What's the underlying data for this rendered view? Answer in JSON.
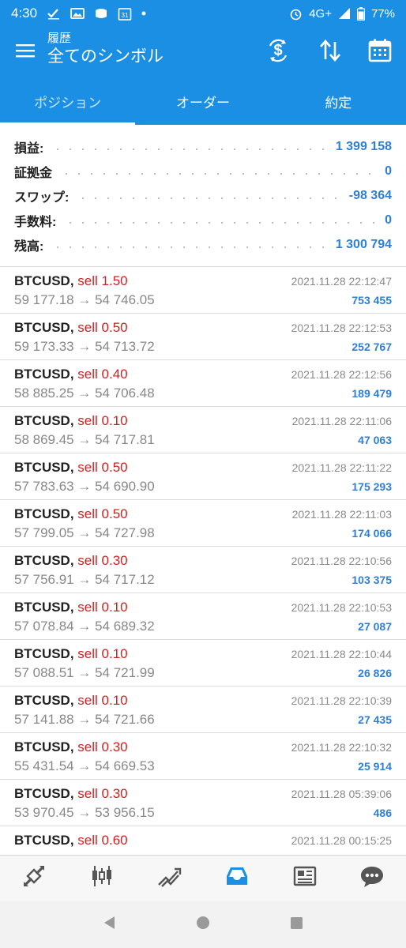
{
  "status_bar": {
    "time": "4:30",
    "network": "4G+",
    "battery": "77%"
  },
  "app_bar": {
    "subtitle": "履歴",
    "title": "全てのシンボル"
  },
  "tabs": [
    {
      "label": "ポジション",
      "active": true
    },
    {
      "label": "オーダー",
      "active": false
    },
    {
      "label": "約定",
      "active": false
    }
  ],
  "summary": [
    {
      "label": "損益:",
      "value": "1 399 158"
    },
    {
      "label": "証拠金",
      "value": "0"
    },
    {
      "label": "スワップ:",
      "value": "-98 364"
    },
    {
      "label": "手数料:",
      "value": "0"
    },
    {
      "label": "残高:",
      "value": "1 300 794"
    }
  ],
  "trades": [
    {
      "symbol": "BTCUSD,",
      "type": "sell 1.50",
      "prices": "59 177.18 → 54 746.05",
      "time": "2021.11.28 22:12:47",
      "profit": "753 455"
    },
    {
      "symbol": "BTCUSD,",
      "type": "sell 0.50",
      "prices": "59 173.33 → 54 713.72",
      "time": "2021.11.28 22:12:53",
      "profit": "252 767"
    },
    {
      "symbol": "BTCUSD,",
      "type": "sell 0.40",
      "prices": "58 885.25 → 54 706.48",
      "time": "2021.11.28 22:12:56",
      "profit": "189 479"
    },
    {
      "symbol": "BTCUSD,",
      "type": "sell 0.10",
      "prices": "58 869.45 → 54 717.81",
      "time": "2021.11.28 22:11:06",
      "profit": "47 063"
    },
    {
      "symbol": "BTCUSD,",
      "type": "sell 0.50",
      "prices": "57 783.63 → 54 690.90",
      "time": "2021.11.28 22:11:22",
      "profit": "175 293"
    },
    {
      "symbol": "BTCUSD,",
      "type": "sell 0.50",
      "prices": "57 799.05 → 54 727.98",
      "time": "2021.11.28 22:11:03",
      "profit": "174 066"
    },
    {
      "symbol": "BTCUSD,",
      "type": "sell 0.30",
      "prices": "57 756.91 → 54 717.12",
      "time": "2021.11.28 22:10:56",
      "profit": "103 375"
    },
    {
      "symbol": "BTCUSD,",
      "type": "sell 0.10",
      "prices": "57 078.84 → 54 689.32",
      "time": "2021.11.28 22:10:53",
      "profit": "27 087"
    },
    {
      "symbol": "BTCUSD,",
      "type": "sell 0.10",
      "prices": "57 088.51 → 54 721.99",
      "time": "2021.11.28 22:10:44",
      "profit": "26 826"
    },
    {
      "symbol": "BTCUSD,",
      "type": "sell 0.10",
      "prices": "57 141.88 → 54 721.66",
      "time": "2021.11.28 22:10:39",
      "profit": "27 435"
    },
    {
      "symbol": "BTCUSD,",
      "type": "sell 0.30",
      "prices": "55 431.54 → 54 669.53",
      "time": "2021.11.28 22:10:32",
      "profit": "25 914"
    },
    {
      "symbol": "BTCUSD,",
      "type": "sell 0.30",
      "prices": "53 970.45 → 53 956.15",
      "time": "2021.11.28 05:39:06",
      "profit": "486"
    },
    {
      "symbol": "BTCUSD,",
      "type": "sell 0.60",
      "prices": "",
      "time": "2021.11.28 00:15:25",
      "profit": ""
    }
  ],
  "bottom_nav": [
    {
      "icon": "quotes-icon",
      "active": false
    },
    {
      "icon": "chart-icon",
      "active": false
    },
    {
      "icon": "trade-icon",
      "active": false
    },
    {
      "icon": "history-icon",
      "active": true
    },
    {
      "icon": "news-icon",
      "active": false
    },
    {
      "icon": "messages-icon",
      "active": false
    }
  ],
  "colors": {
    "primary": "#1a8fe3",
    "profit": "#2f7fd6",
    "sell": "#d02222"
  }
}
